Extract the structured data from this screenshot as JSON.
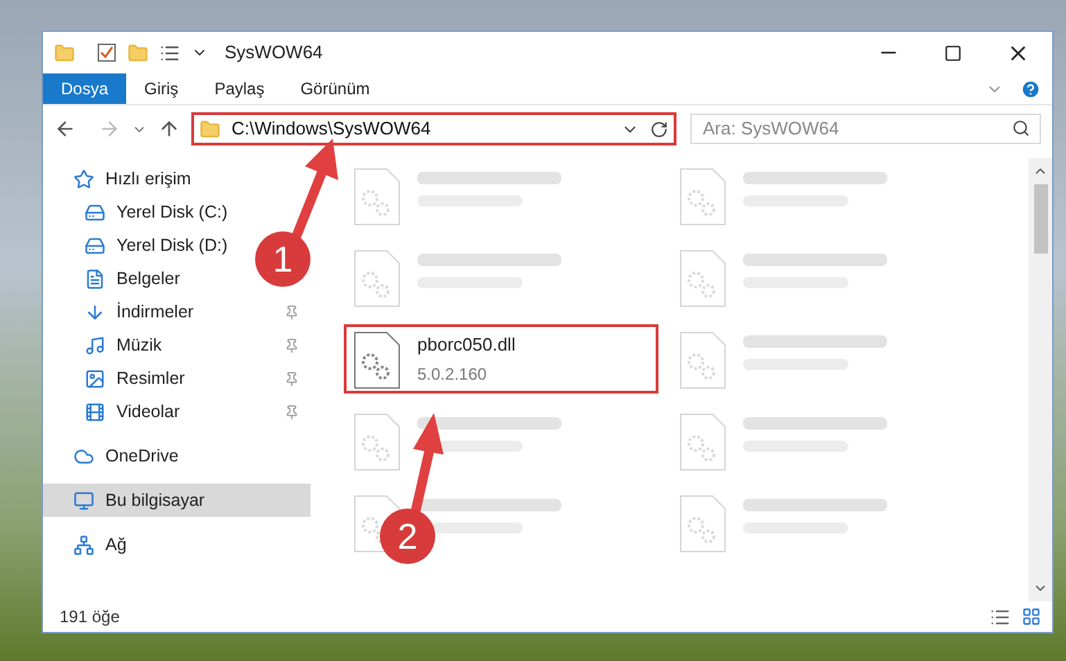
{
  "window": {
    "title": "SysWOW64"
  },
  "ribbon_tabs": [
    {
      "label": "Dosya",
      "selected": true
    },
    {
      "label": "Giriş",
      "selected": false
    },
    {
      "label": "Paylaş",
      "selected": false
    },
    {
      "label": "Görünüm",
      "selected": false
    }
  ],
  "address": {
    "path": "C:\\Windows\\SysWOW64",
    "search_placeholder": "Ara: SysWOW64"
  },
  "sidebar": {
    "items": [
      {
        "label": "Hızlı erişim",
        "kind": "star",
        "pinned": false,
        "selected": false,
        "children": [
          {
            "label": "Yerel Disk (C:)",
            "kind": "drive",
            "pinned": false,
            "selected": false
          },
          {
            "label": "Yerel Disk (D:)",
            "kind": "drive",
            "pinned": false,
            "selected": false
          },
          {
            "label": "Belgeler",
            "kind": "document",
            "pinned": false,
            "selected": false
          },
          {
            "label": "İndirmeler",
            "kind": "download",
            "pinned": true,
            "selected": false
          },
          {
            "label": "Müzik",
            "kind": "music",
            "pinned": true,
            "selected": false
          },
          {
            "label": "Resimler",
            "kind": "pictures",
            "pinned": true,
            "selected": false
          },
          {
            "label": "Videolar",
            "kind": "video",
            "pinned": true,
            "selected": false
          }
        ]
      },
      {
        "label": "OneDrive",
        "kind": "cloud",
        "pinned": false,
        "selected": false
      },
      {
        "label": "Bu bilgisayar",
        "kind": "computer",
        "pinned": false,
        "selected": true
      },
      {
        "label": "Ağ",
        "kind": "network",
        "pinned": false,
        "selected": false
      }
    ]
  },
  "files": [
    {
      "kind": "blurred",
      "highlighted": false
    },
    {
      "kind": "blurred",
      "highlighted": false
    },
    {
      "kind": "blurred",
      "highlighted": false
    },
    {
      "kind": "blurred",
      "highlighted": false
    },
    {
      "kind": "file",
      "name": "pborc050.dll",
      "detail": "5.0.2.160",
      "highlighted": true
    },
    {
      "kind": "blurred",
      "highlighted": false
    },
    {
      "kind": "blurred",
      "highlighted": false
    },
    {
      "kind": "blurred",
      "highlighted": false
    },
    {
      "kind": "blurred",
      "highlighted": false
    },
    {
      "kind": "blurred",
      "highlighted": false
    }
  ],
  "status_bar": {
    "count": "191 öğe"
  },
  "annotations": [
    {
      "number": "1"
    },
    {
      "number": "2"
    }
  ]
}
